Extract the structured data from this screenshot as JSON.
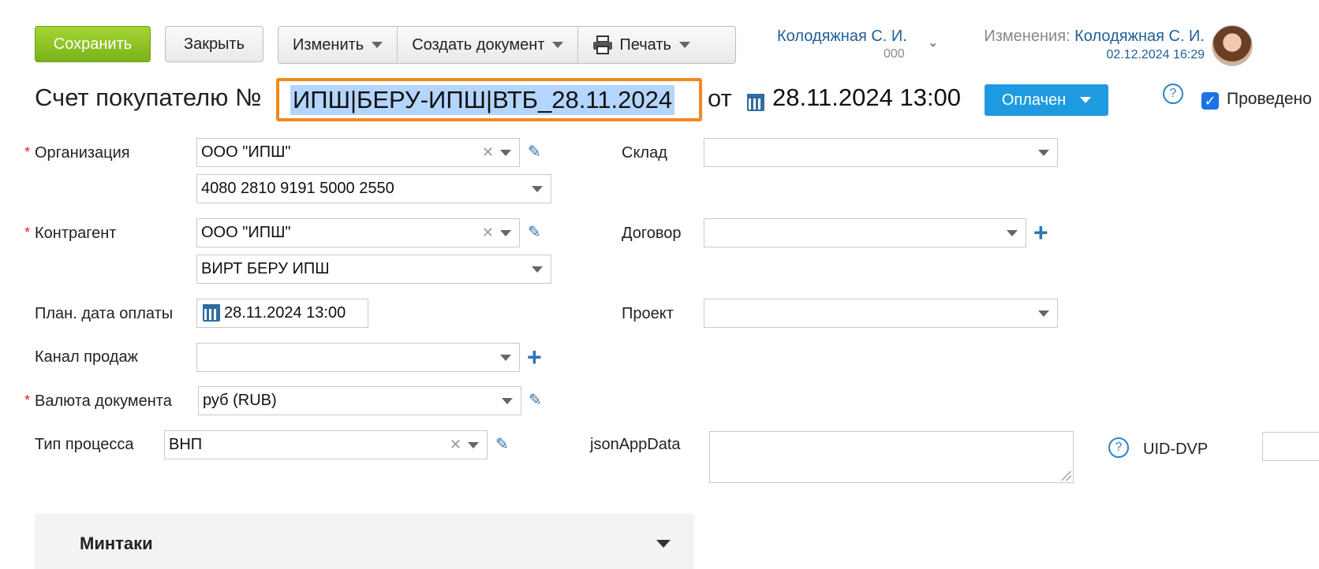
{
  "toolbar": {
    "save_label": "Сохранить",
    "close_label": "Закрыть",
    "change_label": "Изменить",
    "create_doc_label": "Создать документ",
    "print_label": "Печать"
  },
  "user": {
    "name": "Колодяжная С. И.",
    "sub": "000",
    "changes_prefix": "Изменения:",
    "changes_by": "Колодяжная С. И.",
    "changes_date": "02.12.2024 16:29"
  },
  "header": {
    "title": "Счет покупателю №",
    "number": "ИПШ|БЕРУ-ИПШ|ВТБ_28.11.2024",
    "from": "от",
    "date": "28.11.2024 13:00",
    "status": "Оплачен",
    "posted_label": "Проведено",
    "posted": true
  },
  "form": {
    "organization_label": "Организация",
    "organization_value": "ООО \"ИПШ\"",
    "account_value": "4080 2810 9191 5000 2550",
    "contractor_label": "Контрагент",
    "contractor_value": "ООО \"ИПШ\"",
    "contractor_sub_value": "ВИРТ БЕРУ ИПШ",
    "pay_date_label": "План. дата оплаты",
    "pay_date_value": "28.11.2024 13:00",
    "sales_channel_label": "Канал продаж",
    "sales_channel_value": "",
    "currency_label": "Валюта документа",
    "currency_value": "руб (RUB)",
    "process_type_label": "Тип процесса",
    "process_type_value": "ВНП",
    "warehouse_label": "Склад",
    "warehouse_value": "",
    "contract_label": "Договор",
    "contract_value": "",
    "project_label": "Проект",
    "project_value": "",
    "json_label": "jsonAppData",
    "uid_label": "UID-DVP"
  },
  "section": {
    "title": "Минтаки"
  },
  "colors": {
    "accent": "#1e9be0",
    "save": "#8cc423",
    "highlight_border": "#f2881d",
    "selection": "#b4d5fe"
  }
}
